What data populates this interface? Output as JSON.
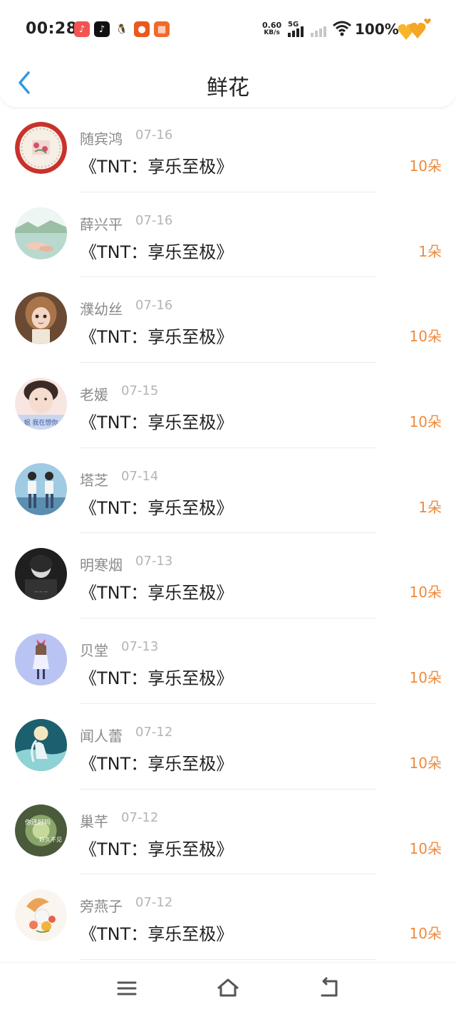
{
  "status": {
    "time": "00:28",
    "speed_value": "0.60",
    "speed_unit": "KB/s",
    "network": "5G",
    "battery": "100%",
    "app_icons": [
      {
        "name": "music-app-icon",
        "color": "#f2544f",
        "glyph": "♪"
      },
      {
        "name": "tiktok-app-icon",
        "color": "#111111",
        "glyph": "♪"
      },
      {
        "name": "qq-penguin-icon",
        "color": "#ffffff",
        "glyph": "🐧"
      },
      {
        "name": "pumpkin-app-icon",
        "color": "#e85a1e",
        "glyph": "●"
      },
      {
        "name": "grid-app-icon",
        "color": "#f06a2a",
        "glyph": "▦"
      }
    ]
  },
  "header": {
    "title": "鲜花"
  },
  "items": [
    {
      "name": "随宾鸿",
      "date": "07-16",
      "gift": "《TNT：享乐至极》",
      "count": "10朵",
      "avatar": "plate"
    },
    {
      "name": "薛兴平",
      "date": "07-16",
      "gift": "《TNT：享乐至极》",
      "count": "1朵",
      "avatar": "landscape"
    },
    {
      "name": "濮幼丝",
      "date": "07-16",
      "gift": "《TNT：享乐至极》",
      "count": "10朵",
      "avatar": "doll"
    },
    {
      "name": "老媛",
      "date": "07-15",
      "gift": "《TNT：享乐至极》",
      "count": "10朵",
      "avatar": "portrait"
    },
    {
      "name": "塔芝",
      "date": "07-14",
      "gift": "《TNT：享乐至极》",
      "count": "1朵",
      "avatar": "couple"
    },
    {
      "name": "明寒烟",
      "date": "07-13",
      "gift": "《TNT：享乐至极》",
      "count": "10朵",
      "avatar": "dark"
    },
    {
      "name": "贝堂",
      "date": "07-13",
      "gift": "《TNT：享乐至极》",
      "count": "10朵",
      "avatar": "girl"
    },
    {
      "name": "闻人蕾",
      "date": "07-12",
      "gift": "《TNT：享乐至极》",
      "count": "10朵",
      "avatar": "sea"
    },
    {
      "name": "巢芊",
      "date": "07-12",
      "gift": "《TNT：享乐至极》",
      "count": "10朵",
      "avatar": "text"
    },
    {
      "name": "旁燕子",
      "date": "07-12",
      "gift": "《TNT：享乐至极》",
      "count": "10朵",
      "avatar": "flower"
    }
  ],
  "avatar_texts": {
    "portrait": "姐 我在想你",
    "text_line1": "你还好吗",
    "text_line2": "好久不见"
  },
  "colors": {
    "accent_blue": "#2f9be8",
    "count_orange": "#ef8a3d"
  }
}
